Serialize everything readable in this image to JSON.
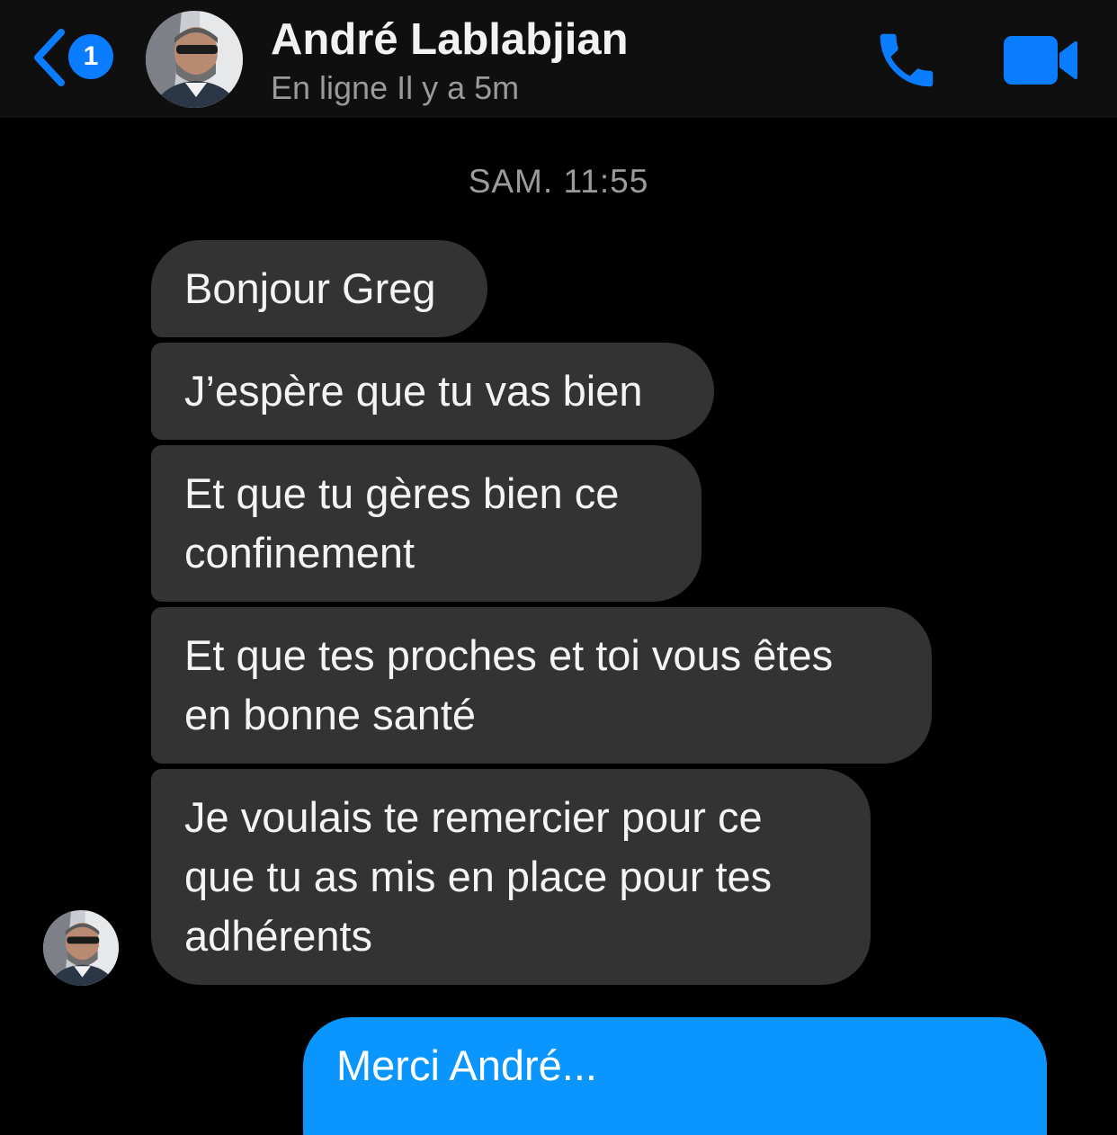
{
  "header": {
    "unread_count": "1",
    "contact_name": "André Lablabjian",
    "status": "En ligne Il y a 5m",
    "back_icon": "chevron-left-icon",
    "call_icon": "phone-icon",
    "video_icon": "video-camera-icon",
    "accent_color": "#0a7cff"
  },
  "conversation": {
    "timestamp": "SAM. 11:55",
    "received": [
      {
        "lines": [
          "Bonjour Greg"
        ]
      },
      {
        "lines": [
          "J’espère que tu vas bien"
        ]
      },
      {
        "lines": [
          "Et que tu gères bien ce",
          "confinement"
        ]
      },
      {
        "lines": [
          "Et que tes proches et toi vous êtes",
          "en bonne santé"
        ]
      },
      {
        "lines": [
          "Je voulais te remercier pour ce",
          "que tu as mis en place pour tes",
          "adhérents"
        ]
      }
    ],
    "sent": [
      {
        "lines": [
          "Merci André..."
        ]
      }
    ],
    "received_bubble_color": "#333333",
    "sent_bubble_color": "#0a95ff"
  }
}
